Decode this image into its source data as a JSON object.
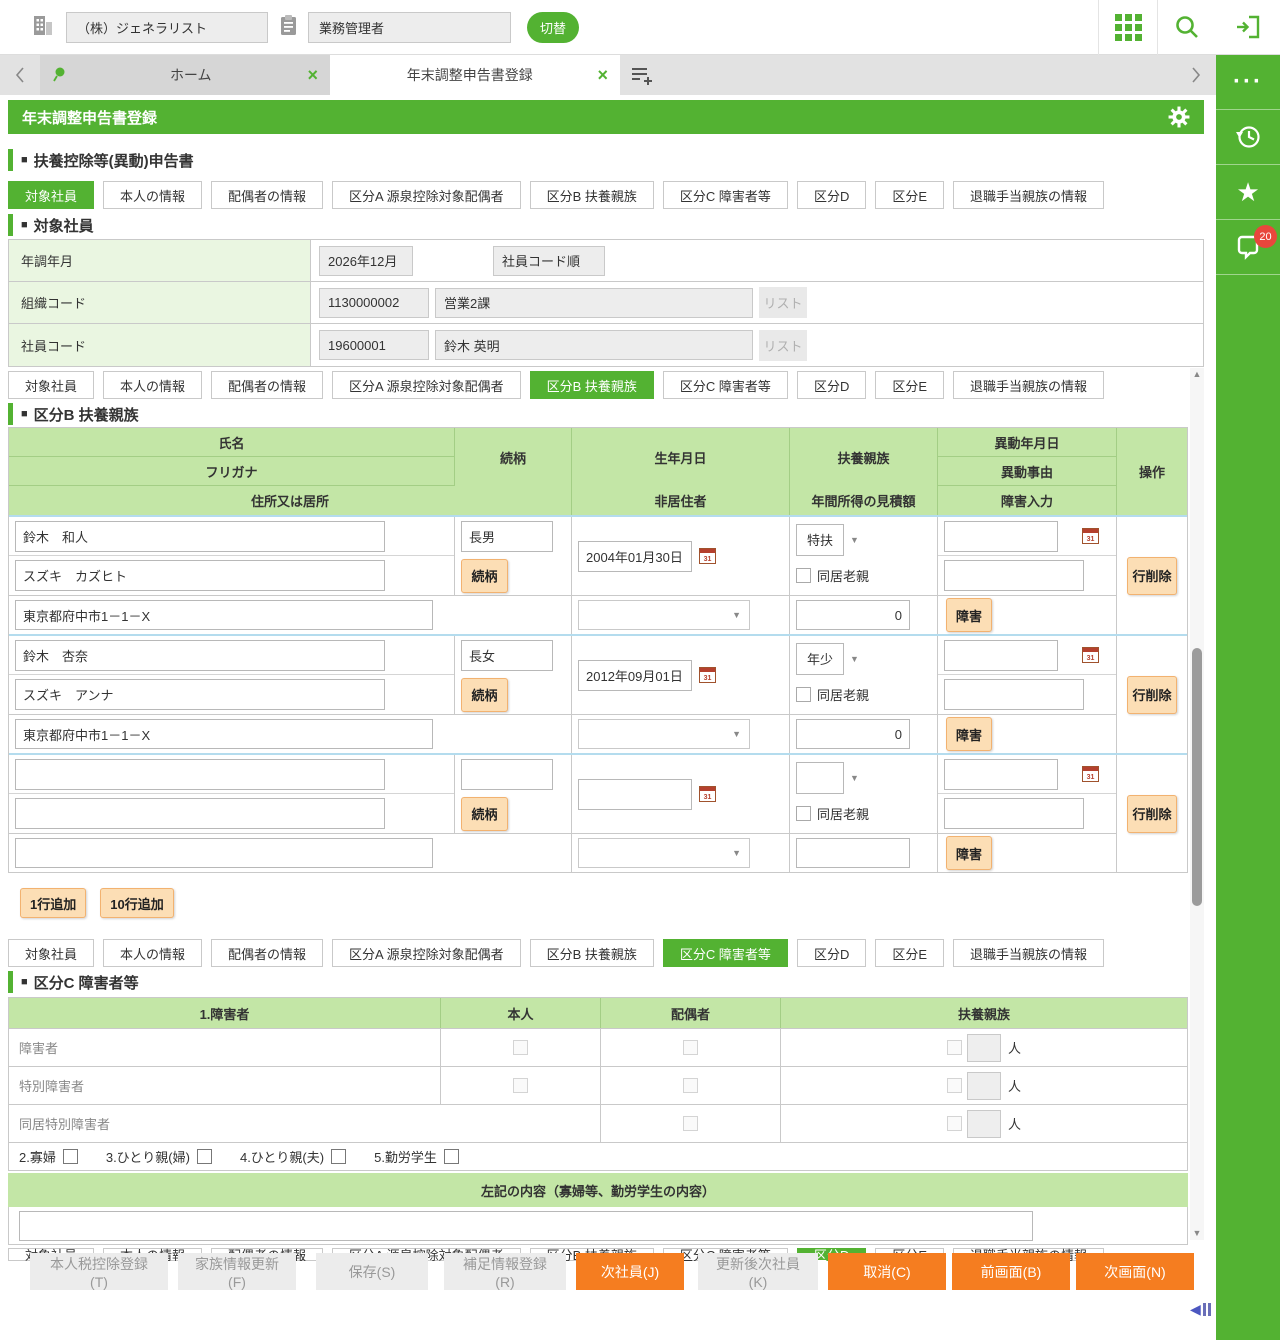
{
  "topbar": {
    "company": "（株）ジェネラリスト",
    "role": "業務管理者",
    "switch_button": "切替"
  },
  "tab_bar": {
    "home": "ホーム",
    "active": "年末調整申告書登録"
  },
  "page": {
    "title": "年末調整申告書登録"
  },
  "sections": {
    "declaration": "扶養控除等(異動)申告書",
    "target": "対象社員",
    "kubun_b": "区分B 扶養親族",
    "kubun_c": "区分C 障害者等"
  },
  "category_tabs": {
    "items": [
      "対象社員",
      "本人の情報",
      "配偶者の情報",
      "区分A 源泉控除対象配偶者",
      "区分B 扶養親族",
      "区分C 障害者等",
      "区分D",
      "区分E",
      "退職手当親族の情報"
    ]
  },
  "target": {
    "year_label": "年調年月",
    "year_value": "2026年12月",
    "order_value": "社員コード順",
    "org_label": "組織コード",
    "org_code": "1130000002",
    "org_name": "営業2課",
    "emp_label": "社員コード",
    "emp_code": "19600001",
    "emp_name": "鈴木 英明",
    "list_button": "リスト"
  },
  "b": {
    "headers": {
      "name": "氏名",
      "kana": "フリガナ",
      "address": "住所又は居所",
      "relation": "続柄",
      "birth": "生年月日",
      "nonresident": "非居住者",
      "dependent": "扶養親族",
      "income": "年間所得の見積額",
      "change_date": "異動年月日",
      "change_reason": "異動事由",
      "disability": "障害入力",
      "operation": "操作"
    },
    "buttons": {
      "relation": "続柄",
      "delete": "行削除",
      "disability": "障害",
      "add_one": "1行追加",
      "add_ten": "10行追加"
    },
    "cohabit": "同居老親",
    "rows": [
      {
        "name": "鈴木　和人",
        "kana": "スズキ　カズヒト",
        "relation": "長男",
        "birth": "2004年01月30日",
        "category": "特扶",
        "address": "東京都府中市1－1－X",
        "income": "0"
      },
      {
        "name": "鈴木　杏奈",
        "kana": "スズキ　アンナ",
        "relation": "長女",
        "birth": "2012年09月01日",
        "category": "年少",
        "address": "東京都府中市1－1－X",
        "income": "0"
      },
      {
        "name": "",
        "kana": "",
        "relation": "",
        "birth": "",
        "category": "",
        "address": "",
        "income": ""
      }
    ]
  },
  "c": {
    "headers": {
      "group": "1.障害者",
      "self": "本人",
      "spouse": "配偶者",
      "dependent": "扶養親族"
    },
    "row_labels": [
      "障害者",
      "特別障害者",
      "同居特別障害者"
    ],
    "person": "人",
    "flags": [
      "2.寡婦",
      "3.ひとり親(婦)",
      "4.ひとり親(夫)",
      "5.勤労学生"
    ],
    "note_header": "左記の内容（寡婦等、勤労学生の内容）"
  },
  "bottom": {
    "items": [
      {
        "label": "本人税控除登録(T)"
      },
      {
        "label": "家族情報更新(F)"
      },
      {
        "label": "保存(S)"
      },
      {
        "label": "補足情報登録(R)"
      },
      {
        "label": "次社員(J)"
      },
      {
        "label": "更新後次社員(K)"
      },
      {
        "label": "取消(C)"
      },
      {
        "label": "前画面(B)"
      },
      {
        "label": "次画面(N)"
      }
    ]
  },
  "sidebar": {
    "badge_count": "20"
  }
}
